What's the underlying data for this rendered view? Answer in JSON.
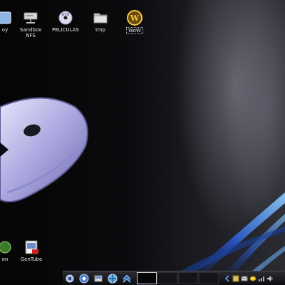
{
  "desktop": {
    "icons": [
      {
        "label": "oy",
        "icon": "home-folder-icon"
      },
      {
        "label": "Sandbox\nNFS",
        "icon": "network-drive-icon"
      },
      {
        "label": "PELICULAS",
        "icon": "dvd-disc-icon"
      },
      {
        "label": "tmp",
        "icon": "folder-icon"
      },
      {
        "label": "WoW",
        "icon": "wow-logo-icon"
      },
      {
        "label": "on",
        "icon": "application-icon"
      },
      {
        "label": "GenTube",
        "icon": "gentube-app-icon"
      }
    ]
  },
  "taskbar": {
    "launchers": [
      "settings-gear-icon",
      "kde-menu-icon",
      "file-manager-icon",
      "web-browser-icon",
      "show-desktop-icon"
    ],
    "pager": {
      "desktops": 4,
      "active": 1
    },
    "tray": [
      "tray-arrow-icon",
      "klipper-icon",
      "mail-icon",
      "chat-icon",
      "network-icon",
      "volume-icon"
    ]
  },
  "colors": {
    "background": "#0b0b0e",
    "accent_blue": "#3a6fd8",
    "mascot_lavender": "#b8b4e8"
  }
}
